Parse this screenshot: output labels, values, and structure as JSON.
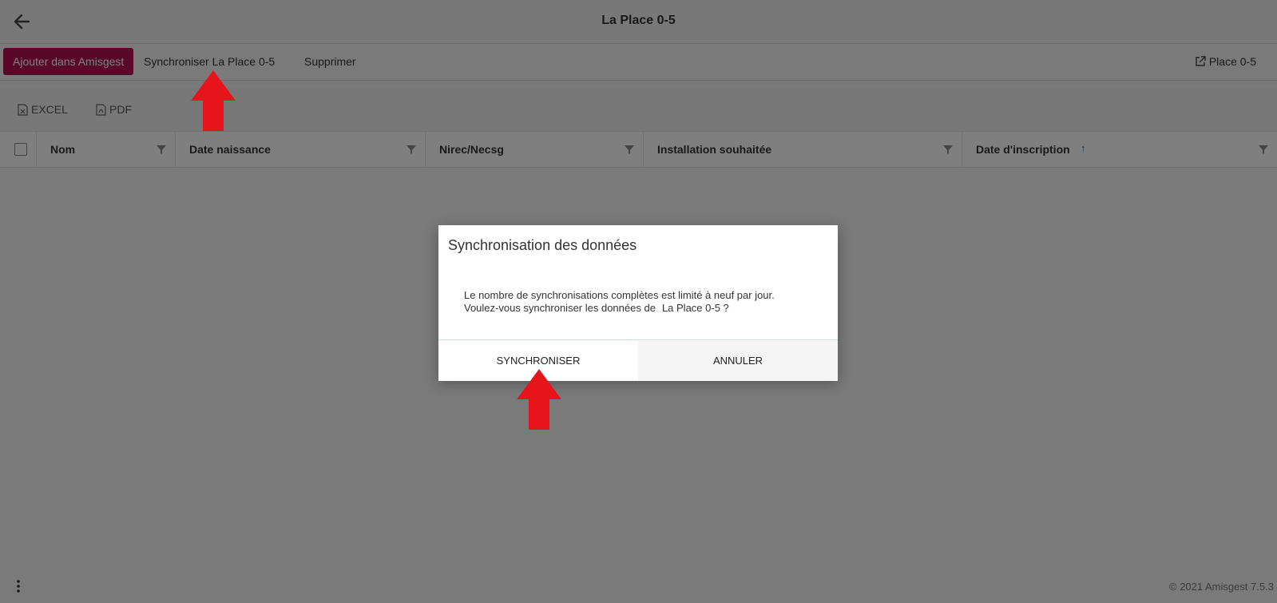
{
  "header": {
    "title": "La Place 0-5"
  },
  "actions": {
    "add_label": "Ajouter dans Amisgest",
    "sync_label": "Synchroniser La Place 0-5",
    "delete_label": "Supprimer",
    "external_label": "Place 0-5"
  },
  "export": {
    "excel_label": "EXCEL",
    "pdf_label": "PDF"
  },
  "table": {
    "columns": [
      {
        "label": "Nom"
      },
      {
        "label": "Date naissance"
      },
      {
        "label": "Nirec/Necsg"
      },
      {
        "label": "Installation souhaitée"
      },
      {
        "label": "Date d'inscription"
      }
    ],
    "sort_indicator": "↑"
  },
  "footer": {
    "copyright": "© 2021 Amisgest 7.5.3"
  },
  "dialog": {
    "title": "Synchronisation des données",
    "line1": "Le nombre de synchronisations complètes est limité à neuf par jour.",
    "line2": "Voulez-vous synchroniser les données de",
    "site_name": "La Place 0-5 ?",
    "confirm_label": "SYNCHRONISER",
    "cancel_label": "ANNULER"
  },
  "colors": {
    "accent": "#b3124f",
    "arrow": "#e8141c",
    "overlay": "rgba(0,0,0,0.5)"
  }
}
